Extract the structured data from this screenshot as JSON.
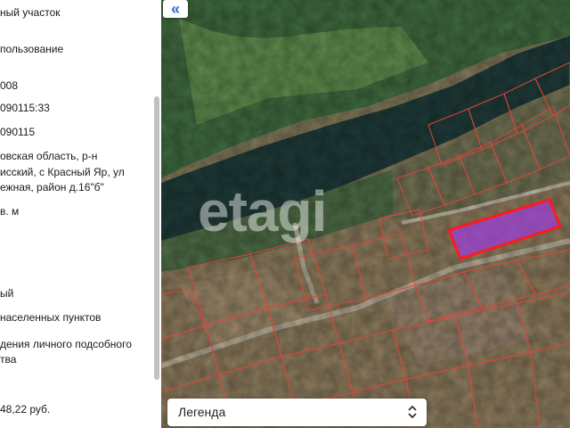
{
  "sidebar": {
    "lines": [
      "ный участок",
      "пользование",
      "008",
      "090115:33",
      "090115",
      "овская область, р-н",
      "исский, с Красный Яр, ул",
      "ежная, район д.16\"б\"",
      "в. м",
      "ый",
      "населенных пунктов",
      "дения личного подсобного",
      "тва",
      "48,22 руб."
    ]
  },
  "map": {
    "collapse_icon": "double-chevron-left-icon",
    "collapse_glyph": "«",
    "watermark": "etagi",
    "legend_label": "Легенда",
    "legend_icon": "up-down-chevron-icon",
    "colors": {
      "parcel_border": "#e0453a",
      "selected_parcel_border": "#ff1a1a",
      "selected_parcel_fill": "#9b3fd6",
      "river": "#1c3c3c",
      "land": "#8a8060",
      "vegetation": "#3b6a3e"
    }
  }
}
